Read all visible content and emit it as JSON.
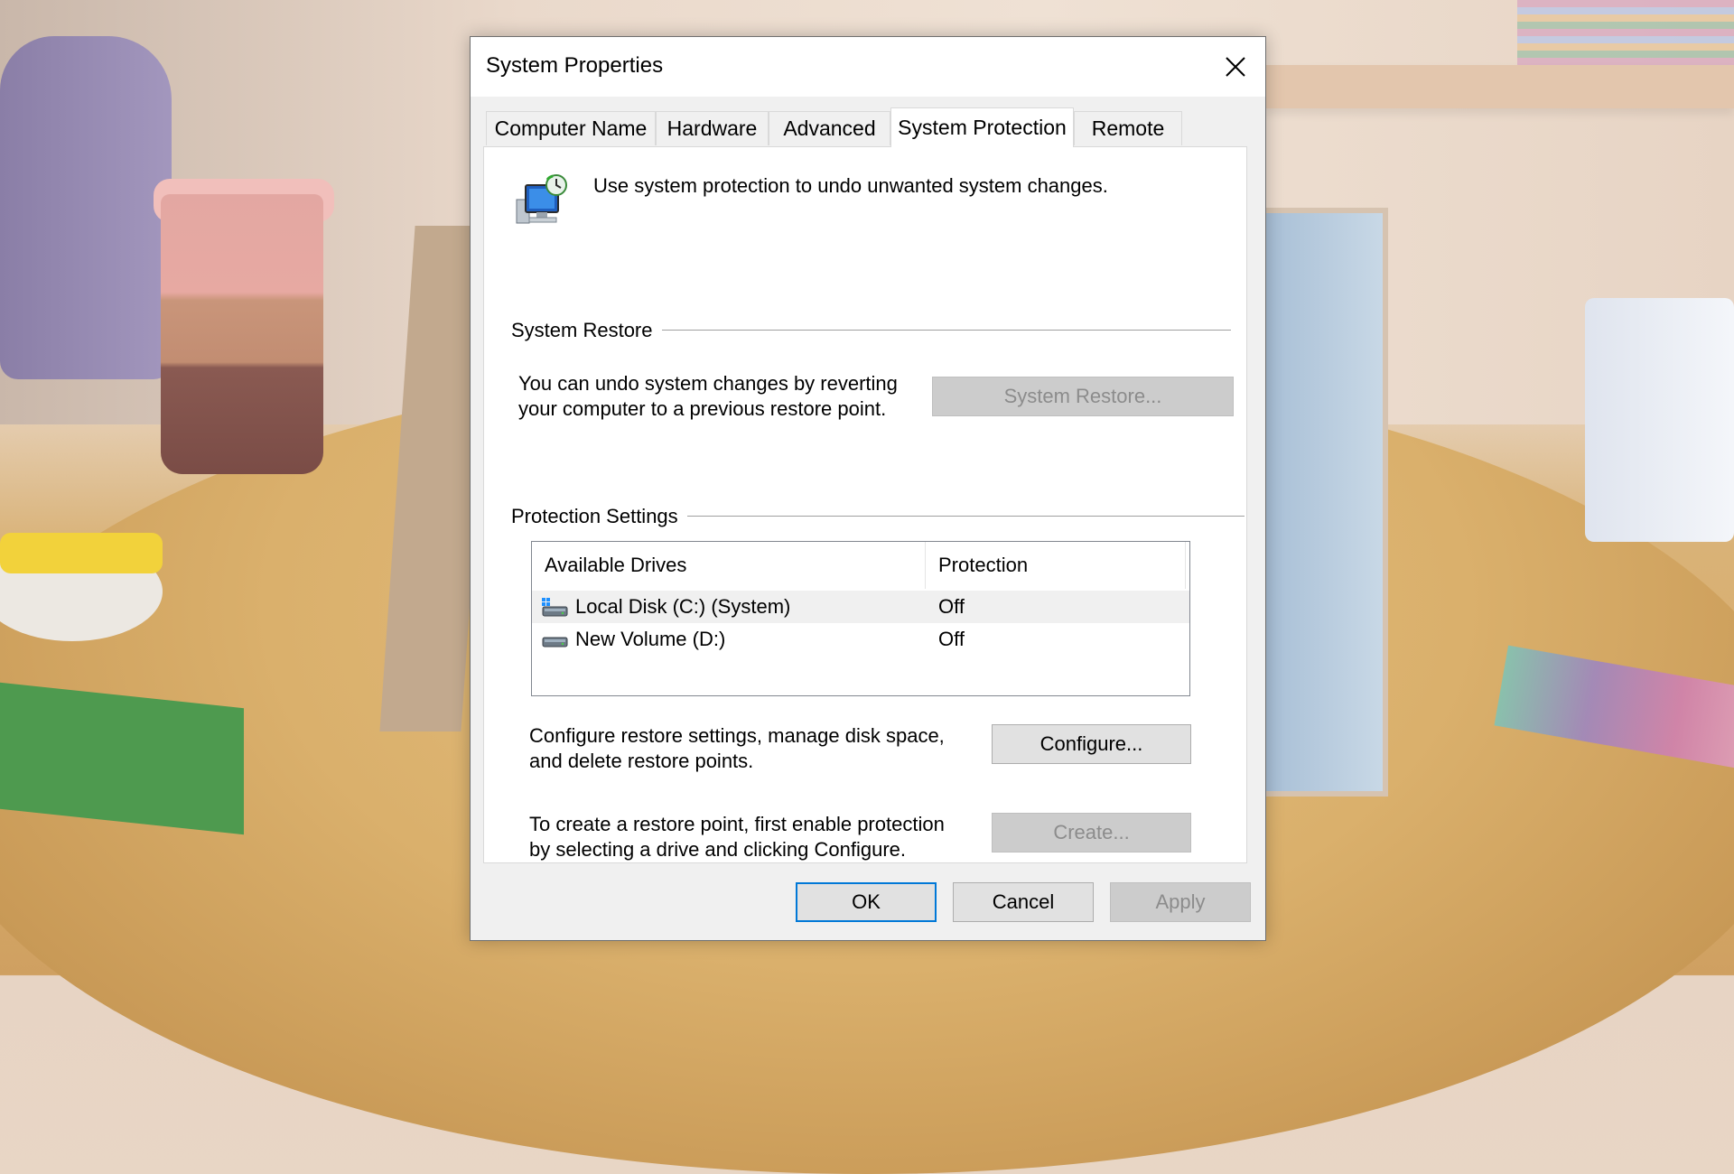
{
  "window": {
    "title": "System Properties"
  },
  "tabs": [
    {
      "label": "Computer Name",
      "active": false
    },
    {
      "label": "Hardware",
      "active": false
    },
    {
      "label": "Advanced",
      "active": false
    },
    {
      "label": "System Protection",
      "active": true
    },
    {
      "label": "Remote",
      "active": false
    }
  ],
  "header": {
    "text": "Use system protection to undo unwanted system changes.",
    "icon": "system-protection-icon"
  },
  "system_restore": {
    "group_label": "System Restore",
    "description_line1": "You can undo system changes by reverting",
    "description_line2": "your computer to a previous restore point.",
    "button_label": "System Restore...",
    "button_enabled": false
  },
  "protection_settings": {
    "group_label": "Protection Settings",
    "columns": [
      "Available Drives",
      "Protection"
    ],
    "drives": [
      {
        "name": "Local Disk (C:) (System)",
        "protection": "Off",
        "icon": "system-drive-icon",
        "selected": true
      },
      {
        "name": "New Volume (D:)",
        "protection": "Off",
        "icon": "drive-icon",
        "selected": false
      }
    ],
    "configure_line1": "Configure restore settings, manage disk space,",
    "configure_line2": "and delete restore points.",
    "configure_label": "Configure...",
    "create_line1": "To create a restore point, first enable protection",
    "create_line2": "by selecting a drive and clicking Configure.",
    "create_label": "Create...",
    "create_enabled": false
  },
  "footer": {
    "ok_label": "OK",
    "cancel_label": "Cancel",
    "apply_label": "Apply",
    "apply_enabled": false
  },
  "colors": {
    "focus_border": "#0078d7",
    "disabled_text": "#8c8c8c",
    "panel_bg": "#ffffff",
    "dialog_bg": "#f0f0f0"
  }
}
